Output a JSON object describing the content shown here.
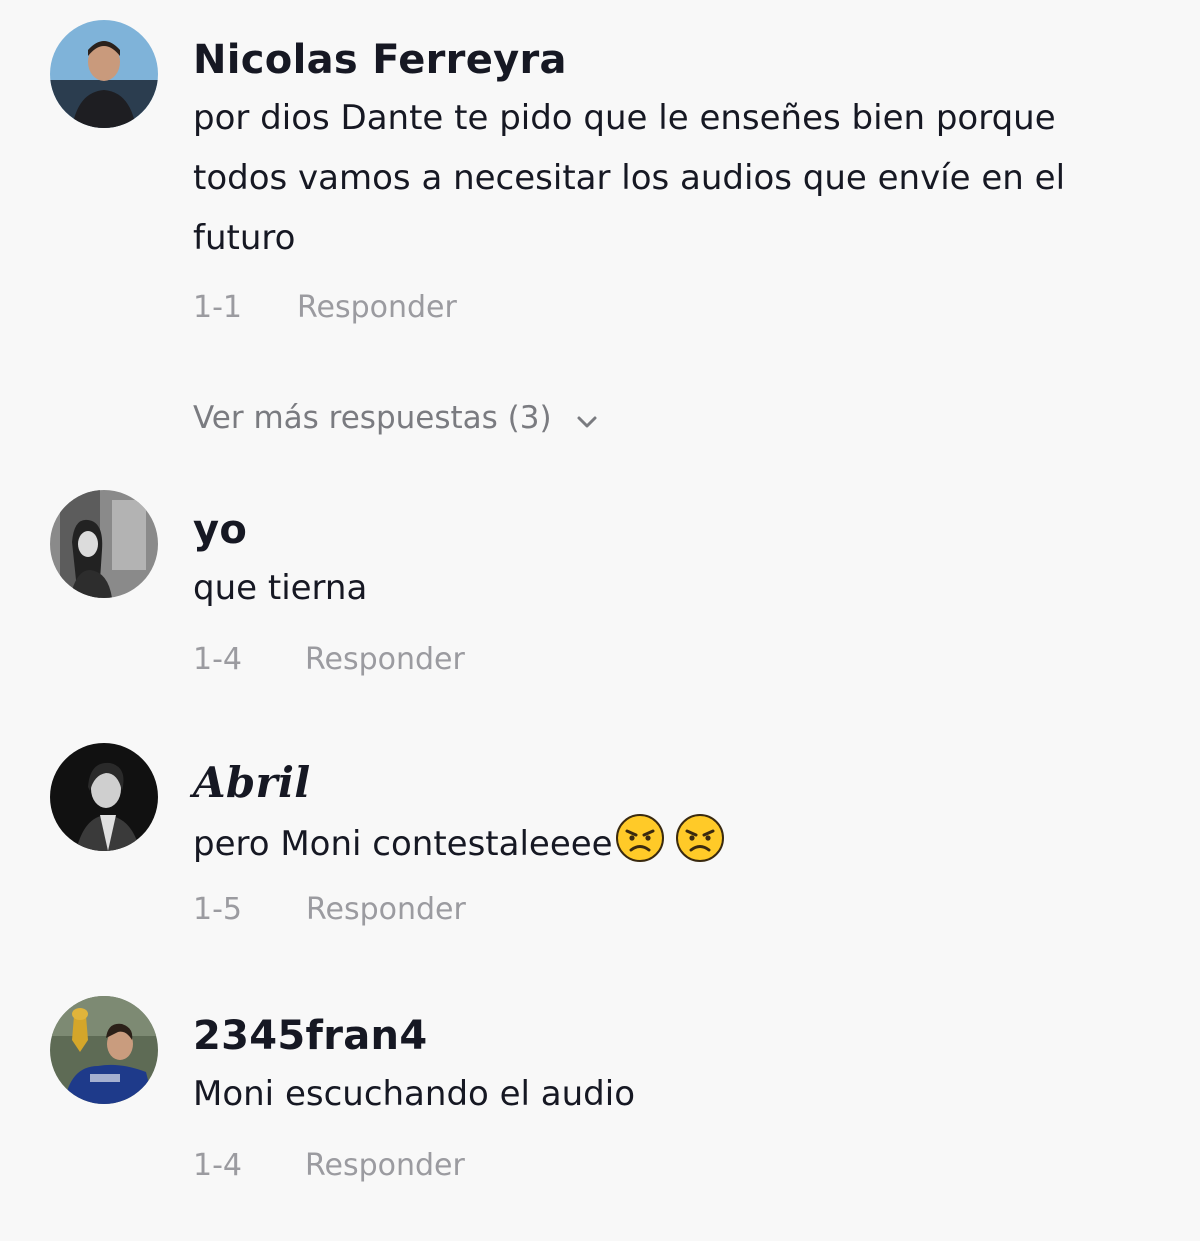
{
  "comments": [
    {
      "username": "Nicolas Ferreyra",
      "text_lines": [
        "por dios Dante te pido que le enseñes bien porque",
        "todos vamos a necesitar los audios que envíe en el",
        "futuro"
      ],
      "date": "1-1",
      "reply_label": "Responder",
      "avatar_icon": "avatar-photo"
    },
    {
      "username": "yo",
      "text": "que tierna",
      "date": "1-4",
      "reply_label": "Responder",
      "avatar_icon": "avatar-photo"
    },
    {
      "username": "𝑨𝒃𝒓𝒊𝒍",
      "text": "pero Moni contestaleeee",
      "emojis": [
        "angry-face-icon",
        "angry-face-icon"
      ],
      "date": "1-5",
      "reply_label": "Responder",
      "avatar_icon": "avatar-photo"
    },
    {
      "username": "2345fran4",
      "text": "Moni escuchando el audio",
      "date": "1-4",
      "reply_label": "Responder",
      "avatar_icon": "avatar-photo"
    }
  ],
  "more_replies": {
    "label": "Ver más respuestas (3)",
    "icon": "chevron-down-icon"
  },
  "colors": {
    "background": "#f8f8f8",
    "text_primary": "#161823",
    "text_secondary": "#9b9ba0",
    "emoji_face": "#ffca28"
  }
}
